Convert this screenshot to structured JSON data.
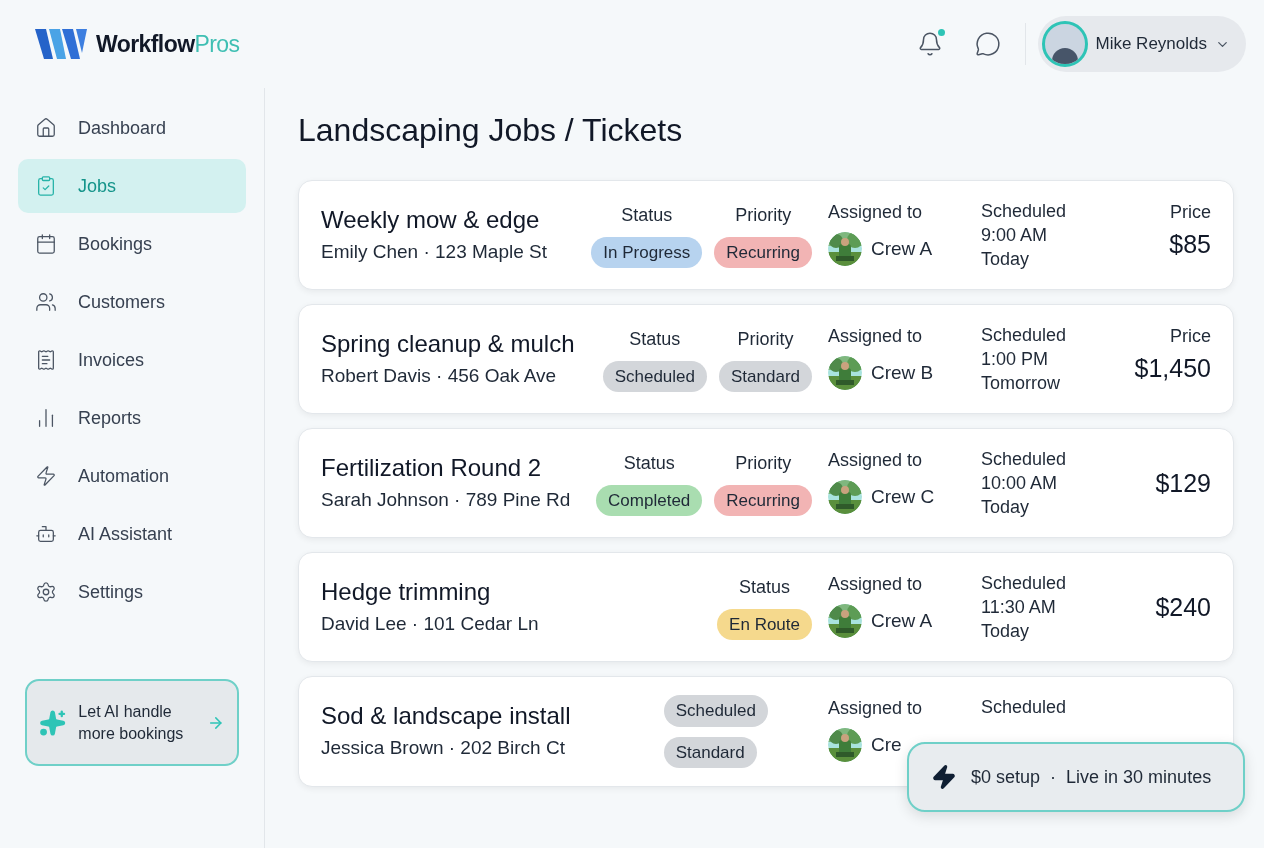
{
  "brand": {
    "name": "Workflow",
    "accent": "Pros"
  },
  "header": {
    "notifications_unread": true,
    "user": {
      "name": "Mike Reynolds"
    }
  },
  "sidebar": {
    "items": [
      {
        "label": "Dashboard",
        "selected": false
      },
      {
        "label": "Jobs",
        "selected": true
      },
      {
        "label": "Bookings",
        "selected": false
      },
      {
        "label": "Customers",
        "selected": false
      },
      {
        "label": "Invoices",
        "selected": false
      },
      {
        "label": "Reports",
        "selected": false
      },
      {
        "label": "Automation",
        "selected": false
      },
      {
        "label": "AI Assistant",
        "selected": false
      },
      {
        "label": "Settings",
        "selected": false
      }
    ],
    "promo": {
      "text": "Let AI handle more bookings"
    }
  },
  "page_title": "Landscaping Jobs / Tickets",
  "jobs": [
    {
      "title": "Weekly mow & edge",
      "subtitle": "Emily Chen · 123 Maple St",
      "kind": "row",
      "tags": [
        {
          "heading": "Status",
          "label": "In Progress",
          "color": "#b7d3ef"
        },
        {
          "heading": "Priority",
          "label": "Recurring",
          "color": "#f2b4b4"
        }
      ],
      "assigned_heading": "Assigned to",
      "crew": "Crew A",
      "scheduled_heading": "Scheduled",
      "time": "9:00 AM",
      "day": "Today",
      "price_heading": "Price",
      "price": "$85"
    },
    {
      "title": "Spring cleanup & mulch",
      "subtitle": "Robert Davis · 456 Oak Ave",
      "kind": "row",
      "tags": [
        {
          "heading": "Status",
          "label": "Scheduled",
          "color": "#d3d6da"
        },
        {
          "heading": "Priority",
          "label": "Standard",
          "color": "#d3d6da"
        }
      ],
      "assigned_heading": "Assigned to",
      "crew": "Crew B",
      "scheduled_heading": "Scheduled",
      "time": "1:00 PM",
      "day": "Tomorrow",
      "price_heading": "Price",
      "price": "$1,450"
    },
    {
      "title": "Fertilization Round 2",
      "subtitle": "Sarah Johnson · 789 Pine Rd",
      "kind": "row",
      "tags": [
        {
          "heading": "Status",
          "label": "Completed",
          "color": "#a9ddb0"
        },
        {
          "heading": "Priority",
          "label": "Recurring",
          "color": "#f2b4b4"
        }
      ],
      "assigned_heading": "Assigned to",
      "crew": "Crew C",
      "scheduled_heading": "Scheduled",
      "time": "10:00 AM",
      "day": "Today",
      "price": "$129"
    },
    {
      "title": "Hedge trimming",
      "subtitle": "David Lee · 101 Cedar Ln",
      "kind": "row",
      "tags": [
        {
          "heading": "Status",
          "label": "En Route",
          "color": "#f5d98d"
        }
      ],
      "assigned_heading": "Assigned to",
      "crew": "Crew A",
      "scheduled_heading": "Scheduled",
      "time": "11:30 AM",
      "day": "Today",
      "price": "$240"
    },
    {
      "title": "Sod & landscape install",
      "subtitle": "Jessica Brown · 202 Birch Ct",
      "kind": "stack",
      "tags": [
        {
          "label": "Scheduled",
          "color": "#d3d6da"
        },
        {
          "label": "Standard",
          "color": "#d3d6da"
        }
      ],
      "assigned_heading": "Assigned to",
      "crew": "Cre",
      "scheduled_heading": "Scheduled"
    }
  ],
  "toast": {
    "setup": "$0 setup",
    "separator": "·",
    "live": "Live in 30 minutes"
  }
}
